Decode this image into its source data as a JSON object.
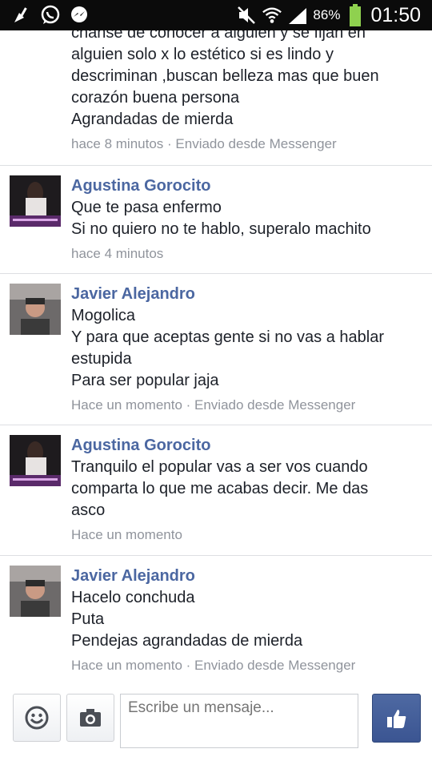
{
  "status_bar": {
    "battery": "86%",
    "time": "01:50",
    "left_icons": [
      "clean-master-icon",
      "whatsapp-icon",
      "facebook-messenger-icon"
    ],
    "right_icons": [
      "mute-icon",
      "wifi-icon",
      "signal-icon",
      "battery-icon"
    ]
  },
  "thread": {
    "messages": [
      {
        "author": "",
        "lines": [
          "chanse de conocer a alguien y se fijan en",
          "alguien solo x lo estético si es lindo y",
          "descriminan ,buscan belleza mas que buen",
          "corazón buena persona",
          "Agrandadas de mierda"
        ],
        "meta": "hace 8 minutos · Enviado desde Messenger"
      },
      {
        "author": "Agustina Gorocito",
        "lines": [
          "Que te pasa enfermo",
          "Si no quiero no te hablo, superalo machito"
        ],
        "meta": "hace 4 minutos"
      },
      {
        "author": "Javier Alejandro",
        "lines": [
          "Mogolica",
          "Y para que aceptas gente si no vas a hablar",
          "estupida",
          "Para ser popular jaja"
        ],
        "meta": "Hace un momento · Enviado desde Messenger"
      },
      {
        "author": "Agustina Gorocito",
        "lines": [
          "Tranquilo el popular vas a ser vos cuando",
          "comparta lo que me acabas decir. Me das",
          "asco"
        ],
        "meta": "Hace un momento"
      },
      {
        "author": "Javier Alejandro",
        "lines": [
          "Hacelo conchuda",
          "Puta",
          "Pendejas agrandadas de mierda"
        ],
        "meta": "Hace un momento · Enviado desde Messenger"
      }
    ]
  },
  "composer": {
    "placeholder": "Escribe un mensaje...",
    "value": ""
  },
  "colors": {
    "author": "#4b67a1",
    "text": "#1d2129",
    "meta": "#90949c",
    "like_button": "#3b5592",
    "status_bar": "#0b0b0b"
  }
}
